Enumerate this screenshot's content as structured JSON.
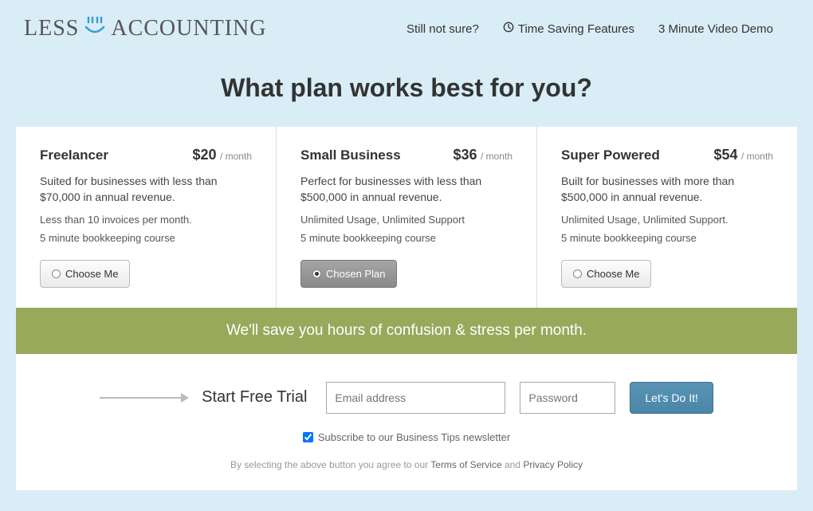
{
  "header": {
    "logo": {
      "less": "LESS",
      "accounting": "ACCOUNTING"
    },
    "still_not_sure": "Still not sure?",
    "time_saving": "Time Saving Features",
    "video_demo": "3 Minute Video Demo"
  },
  "heading": "What plan works best for you?",
  "plans": [
    {
      "name": "Freelancer",
      "price": "$20",
      "period": "/ month",
      "desc": "Suited for businesses with less than $70,000 in annual revenue.",
      "feat1": "Less than 10 invoices per month.",
      "feat2": "5 minute bookkeeping course",
      "button": "Choose Me",
      "chosen": false
    },
    {
      "name": "Small Business",
      "price": "$36",
      "period": "/ month",
      "desc": "Perfect for businesses with less than $500,000 in annual revenue.",
      "feat1": "Unlimited Usage, Unlimited Support",
      "feat2": "5 minute bookkeeping course",
      "button": "Chosen Plan",
      "chosen": true
    },
    {
      "name": "Super Powered",
      "price": "$54",
      "period": "/ month",
      "desc": "Built for businesses with more than $500,000 in annual revenue.",
      "feat1": "Unlimited Usage, Unlimited Support.",
      "feat2": "5 minute bookkeeping course",
      "button": "Choose Me",
      "chosen": false
    }
  ],
  "banner": "We'll save you hours of confusion & stress per month.",
  "signup": {
    "label": "Start Free Trial",
    "email_placeholder": "Email address",
    "password_placeholder": "Password",
    "button": "Let's Do It!",
    "newsletter": "Subscribe to our Business Tips newsletter",
    "legal_pre": "By selecting the above button you agree to our ",
    "tos": "Terms of Service",
    "legal_and": " and ",
    "privacy": "Privacy Policy"
  }
}
